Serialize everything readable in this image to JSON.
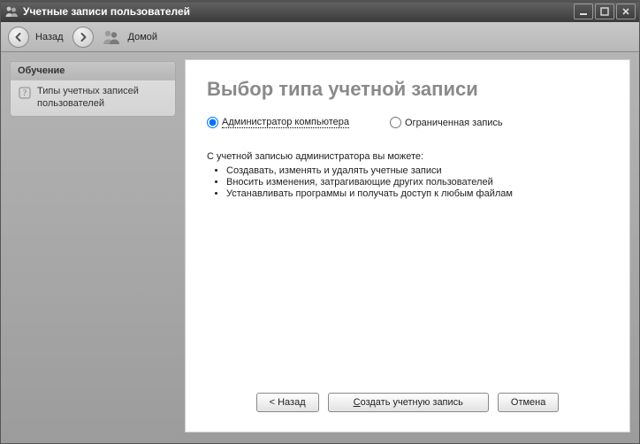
{
  "window": {
    "title": "Учетные записи пользователей"
  },
  "toolbar": {
    "back_label": "Назад",
    "home_label": "Домой"
  },
  "sidebar": {
    "heading": "Обучение",
    "item1": "Типы учетных записей пользователей"
  },
  "main": {
    "heading": "Выбор типа учетной записи",
    "radio_admin": "Администратор компьютера",
    "radio_limited": "Ограниченная запись",
    "desc_intro": "С учетной записью администратора вы можете:",
    "desc_b1": "Создавать, изменять и удалять учетные записи",
    "desc_b2": "Вносить изменения, затрагивающие других пользователей",
    "desc_b3": "Устанавливать программы и получать доступ к любым файлам"
  },
  "buttons": {
    "back": "< Назад",
    "create": "Создать учетную запись",
    "cancel": "Отмена"
  }
}
